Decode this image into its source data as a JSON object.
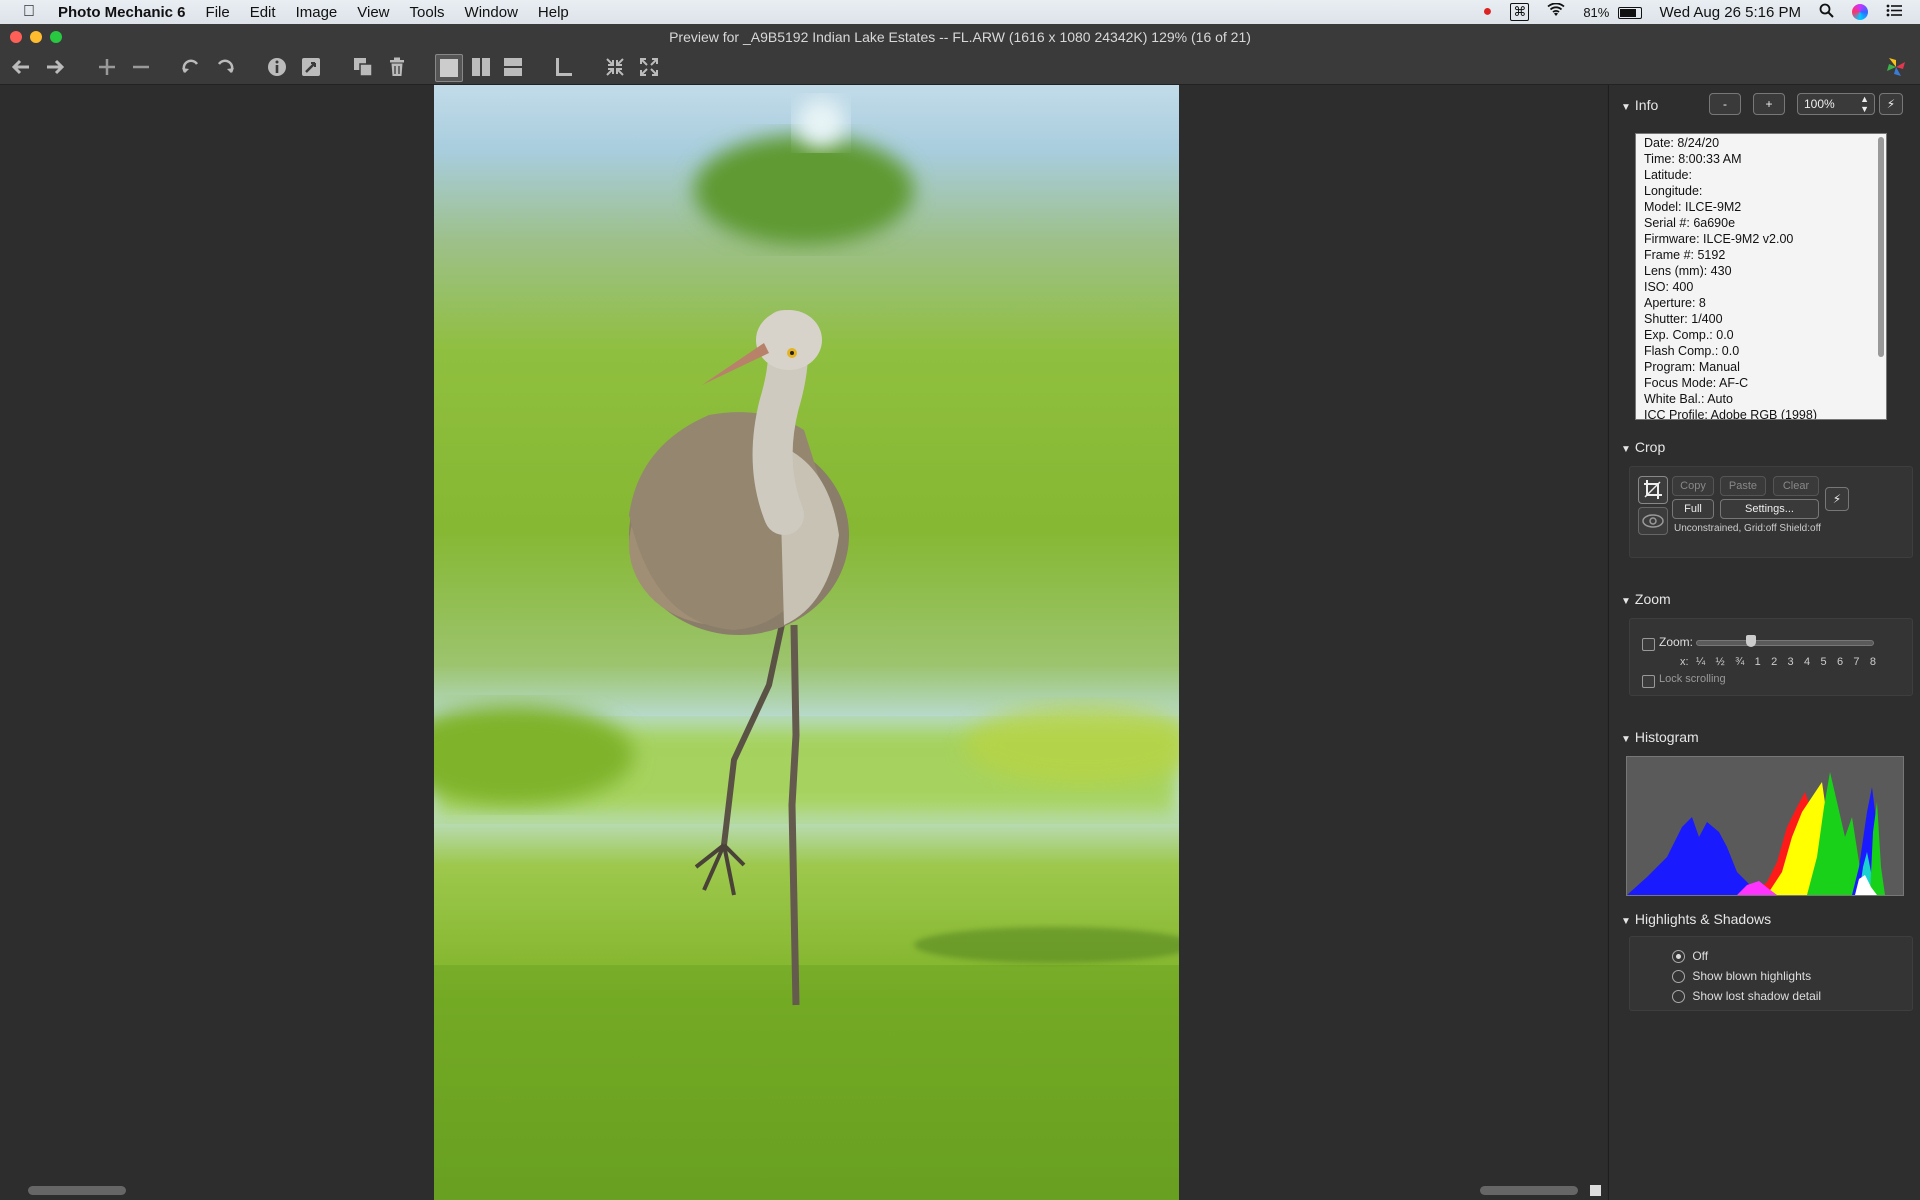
{
  "menubar": {
    "app_name": "Photo Mechanic 6",
    "items": [
      "File",
      "Edit",
      "Image",
      "View",
      "Tools",
      "Window",
      "Help"
    ],
    "battery": "81%",
    "clock": "Wed Aug 26  5:16 PM"
  },
  "window": {
    "title": "Preview for _A9B5192 Indian Lake Estates -- FL.ARW (1616 x 1080 24342K) 129% (16 of 21)"
  },
  "info": {
    "header": "Info",
    "minus_label": "-",
    "plus_label": "+",
    "zoom_value": "100%",
    "rows": [
      "Date: 8/24/20",
      "Time: 8:00:33 AM",
      "Latitude:",
      "Longitude:",
      "Model: ILCE-9M2",
      "Serial #: 6a690e",
      "Firmware: ILCE-9M2 v2.00",
      "Frame #: 5192",
      "Lens (mm): 430",
      "ISO: 400",
      "Aperture: 8",
      "Shutter: 1/400",
      "Exp. Comp.: 0.0",
      "Flash Comp.: 0.0",
      "Program: Manual",
      "Focus Mode: AF-C",
      "White Bal.: Auto",
      "ICC Profile: Adobe RGB (1998)"
    ]
  },
  "crop": {
    "header": "Crop",
    "copy": "Copy",
    "paste": "Paste",
    "clear": "Clear",
    "full": "Full",
    "settings": "Settings...",
    "status": "Unconstrained, Grid:off Shield:off"
  },
  "zoom": {
    "header": "Zoom",
    "label": "Zoom:",
    "x_label": "x:",
    "ticks": [
      "¼",
      "½",
      "¾",
      "1",
      "2",
      "3",
      "4",
      "5",
      "6",
      "7",
      "8"
    ],
    "lock_label": "Lock scrolling"
  },
  "histogram": {
    "header": "Histogram"
  },
  "highlights": {
    "header": "Highlights & Shadows",
    "options": [
      "Off",
      "Show blown highlights",
      "Show lost shadow detail"
    ],
    "selected": "Off"
  }
}
